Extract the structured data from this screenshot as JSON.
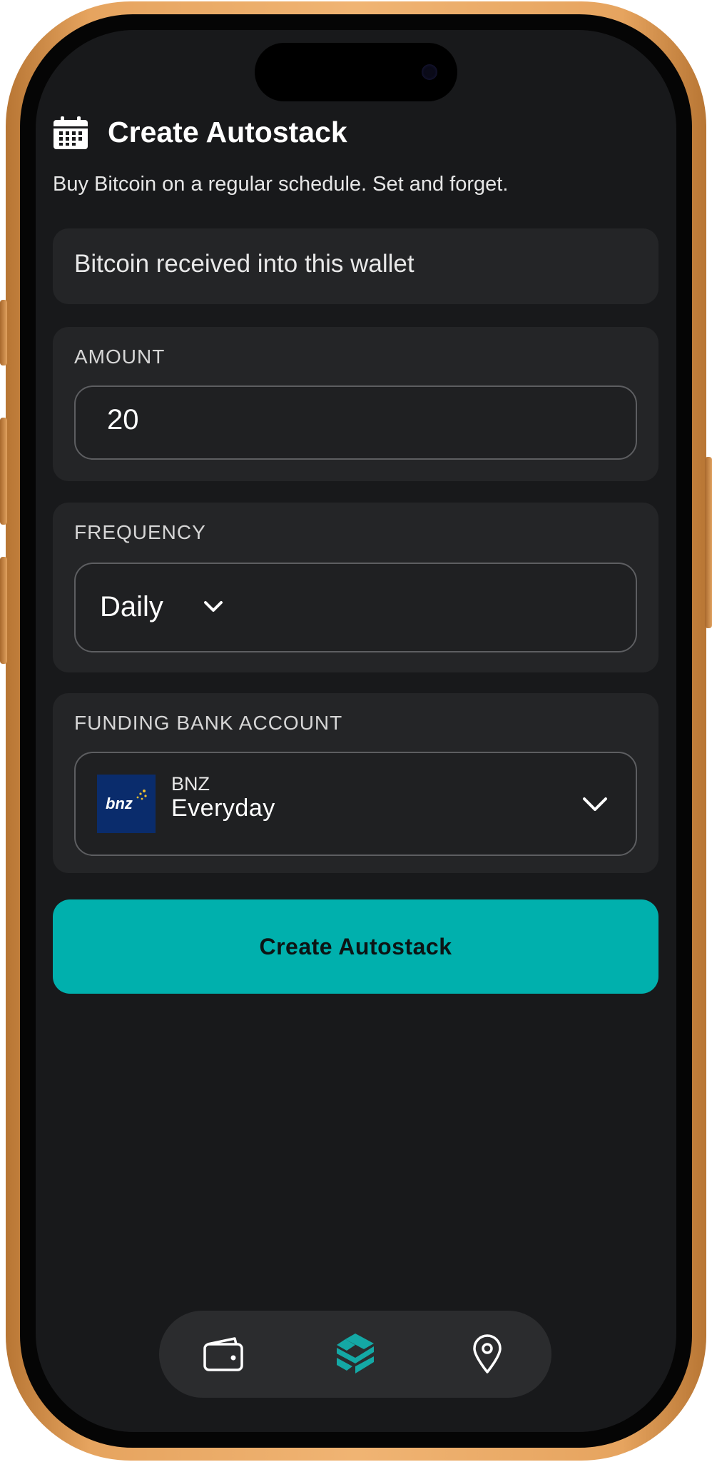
{
  "header": {
    "title": "Create Autostack",
    "subtitle": "Buy Bitcoin on a regular schedule. Set and forget.",
    "icon": "calendar-icon"
  },
  "wallet": {
    "text": "Bitcoin received into this wallet"
  },
  "amount": {
    "label": "AMOUNT",
    "value": "20"
  },
  "frequency": {
    "label": "FREQUENCY",
    "selected": "Daily",
    "icon": "chevron-down-icon"
  },
  "funding": {
    "label": "FUNDING BANK ACCOUNT",
    "logo_text": "bnz",
    "bank_name": "BNZ",
    "account_name": "Everyday",
    "icon": "chevron-down-icon"
  },
  "create_button": {
    "label": "Create Autostack",
    "color": "#00b0ad"
  },
  "bottom_nav": {
    "items": [
      {
        "icon": "wallet-icon"
      },
      {
        "icon": "stack-logo-icon",
        "active": true,
        "color": "#14a8a5"
      },
      {
        "icon": "location-pin-icon"
      }
    ]
  },
  "colors": {
    "background": "#18191b",
    "card": "#242527",
    "accent": "#00b0ad",
    "frame": "#e6a45f"
  }
}
